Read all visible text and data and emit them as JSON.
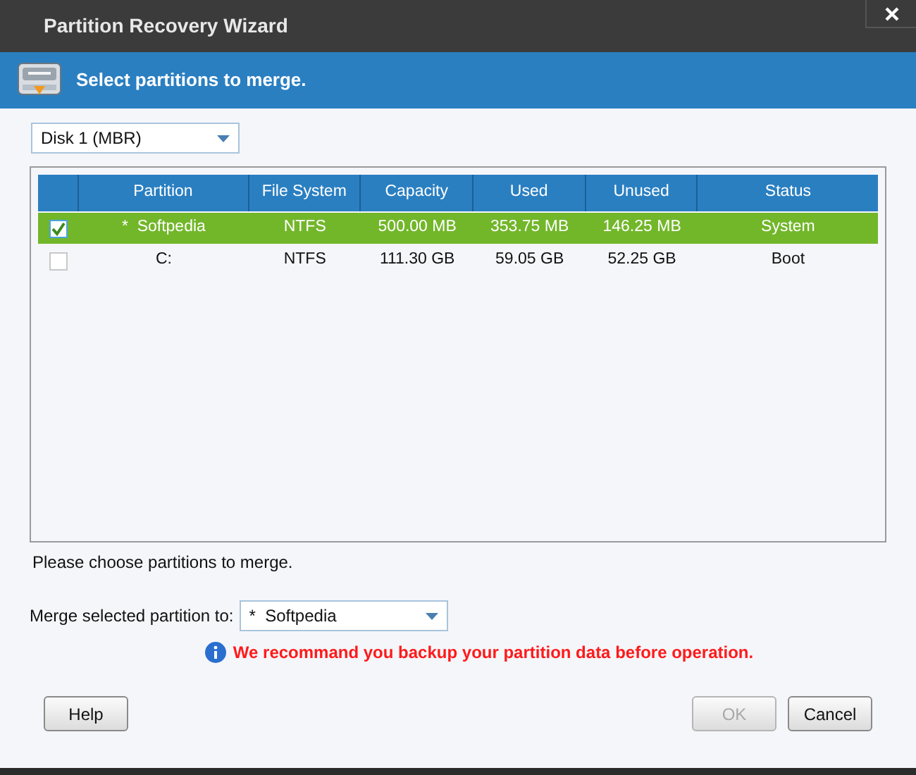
{
  "window": {
    "title": "Partition Recovery Wizard"
  },
  "banner": {
    "title": "Select partitions to merge."
  },
  "disk_select": {
    "value": "Disk 1 (MBR)"
  },
  "table": {
    "columns": [
      "Partition",
      "File System",
      "Capacity",
      "Used",
      "Unused",
      "Status"
    ],
    "rows": [
      {
        "checked": true,
        "selected": true,
        "cells": [
          "*  Softpedia",
          "NTFS",
          "500.00 MB",
          "353.75 MB",
          "146.25 MB",
          "System"
        ]
      },
      {
        "checked": false,
        "selected": false,
        "cells": [
          "C:",
          "NTFS",
          "111.30 GB",
          "59.05 GB",
          "52.25 GB",
          "Boot"
        ]
      }
    ]
  },
  "hint": "Please choose partitions to merge.",
  "merge_target": {
    "label": "Merge selected partition to:",
    "value": "*  Softpedia"
  },
  "warning": "We recommand you backup your partition data before operation.",
  "buttons": [
    {
      "label": "Help",
      "disabled": false
    },
    {
      "label": "OK",
      "disabled": true
    },
    {
      "label": "Cancel",
      "disabled": false
    }
  ]
}
